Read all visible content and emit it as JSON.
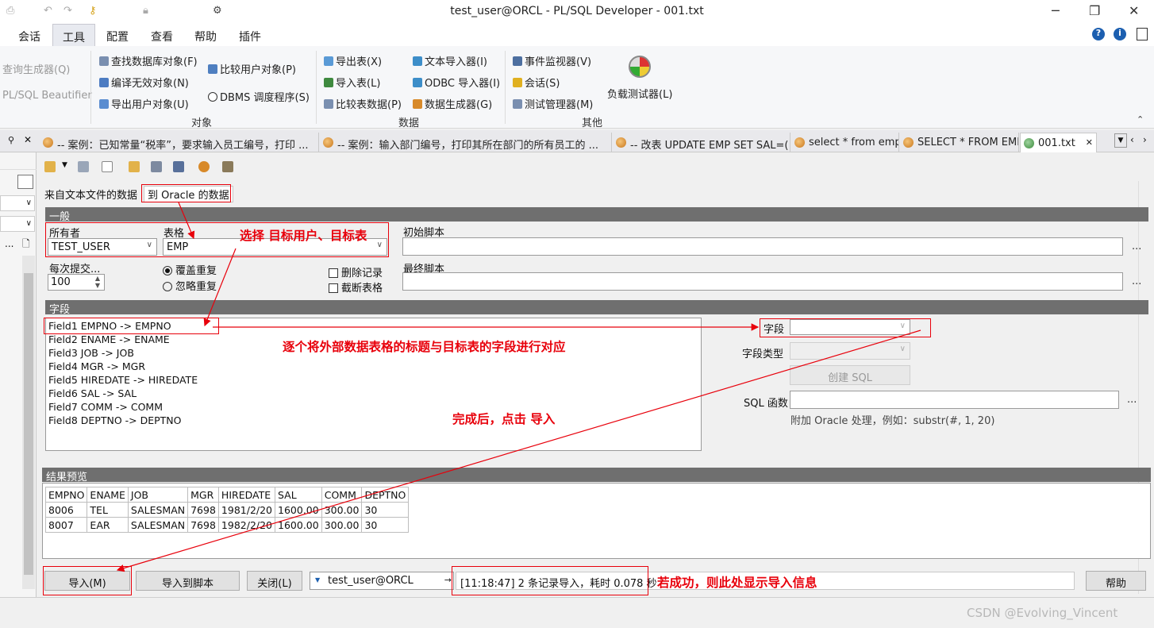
{
  "window": {
    "title": "test_user@ORCL - PL/SQL Developer - 001.txt"
  },
  "menubar": [
    "会话",
    "工具",
    "配置",
    "查看",
    "帮助",
    "插件"
  ],
  "ribbon": {
    "left_disabled": [
      "查询生成器(Q)",
      "PL/SQL Beautifier"
    ],
    "objects": [
      "查找数据库对象(F)",
      "编译无效对象(N)",
      "导出用户对象(U)",
      "比较用户对象(P)",
      "DBMS 调度程序(S)"
    ],
    "objects_group": "对象",
    "data": [
      "导出表(X)",
      "导入表(L)",
      "比较表数据(P)",
      "文本导入器(I)",
      "ODBC 导入器(I)",
      "数据生成器(G)"
    ],
    "data_group": "数据",
    "other": [
      "事件监视器(V)",
      "会话(S)",
      "测试管理器(M)",
      "负载测试器(L)"
    ],
    "other_group": "其他"
  },
  "doc_tabs": [
    "-- 案例：已知常量“税率”，要求输入员工编号，打印 ...",
    "-- 案例：输入部门编号，打印其所在部门的所有员工的 ...",
    "-- 改表 UPDATE EMP SET SAL=( ...",
    "select * from emp;",
    "SELECT * FROM EMP;",
    "001.txt"
  ],
  "subtabs": {
    "from_text": "来自文本文件的数据",
    "to_oracle": "到 Oracle 的数据"
  },
  "general": {
    "header": "一般",
    "owner_label": "所有者",
    "owner_value": "TEST_USER",
    "table_label": "表格",
    "table_value": "EMP",
    "commit_label": "每次提交...",
    "commit_value": "100",
    "radio_overwrite": "覆盖重复",
    "radio_ignore": "忽略重复",
    "chk_delete": "删除记录",
    "chk_truncate": "截断表格",
    "init_script_label": "初始脚本",
    "final_script_label": "最终脚本"
  },
  "fields": {
    "header": "字段",
    "list": [
      "Field1  EMPNO  ->  EMPNO",
      "Field2  ENAME  ->  ENAME",
      "Field3  JOB  ->  JOB",
      "Field4  MGR  ->  MGR",
      "Field5  HIREDATE  ->  HIREDATE",
      "Field6  SAL  ->  SAL",
      "Field7  COMM  ->  COMM",
      "Field8  DEPTNO  ->  DEPTNO"
    ],
    "field_label": "字段",
    "field_type_label": "字段类型",
    "create_sql": "创建 SQL",
    "sql_func_label": "SQL 函数",
    "sql_hint": "附加 Oracle 处理，例如：substr(#, 1, 20)"
  },
  "preview": {
    "header": "结果预览",
    "columns": [
      "EMPNO",
      "ENAME",
      "JOB",
      "MGR",
      "HIREDATE",
      "SAL",
      "COMM",
      "DEPTNO"
    ],
    "rows": [
      [
        "8006",
        "TEL",
        "SALESMAN",
        "7698",
        "1981/2/20",
        "1600.00",
        "300.00",
        "30"
      ],
      [
        "8007",
        "EAR",
        "SALESMAN",
        "7698",
        "1982/2/20",
        "1600.00",
        "300.00",
        "30"
      ]
    ]
  },
  "buttons": {
    "import": "导入(M)",
    "import_script": "导入到脚本",
    "close": "关闭(L)",
    "help": "帮助",
    "connection": "test_user@ORCL"
  },
  "status_msg": "[11:18:47]  2 条记录导入，耗时 0.078 秒",
  "annotations": {
    "select_target": "选择 目标用户、目标表",
    "map_fields": "逐个将外部数据表格的标题与目标表的字段进行对应",
    "click_import": "完成后，点击  导入",
    "success_info": "若成功，则此处显示导入信息"
  },
  "watermark": "CSDN @Evolving_Vincent",
  "colors": {
    "annotation": "#e8000b",
    "section_header": "#6f6f6f"
  }
}
